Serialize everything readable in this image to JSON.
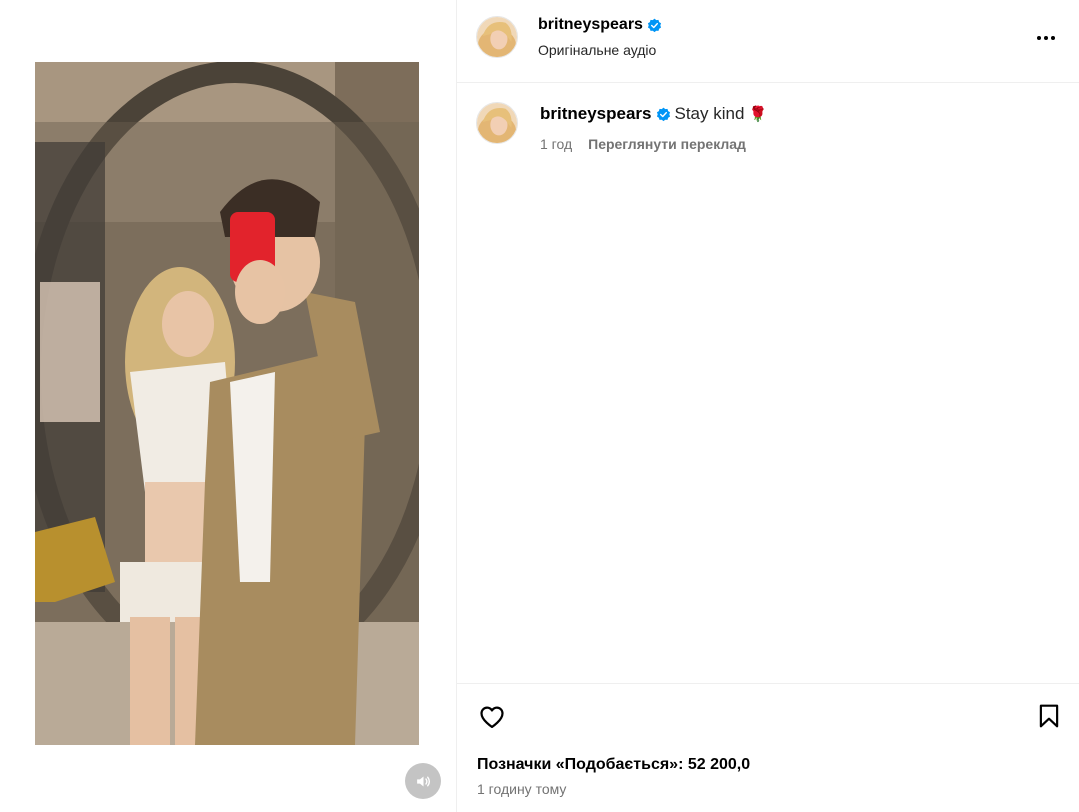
{
  "post": {
    "username": "britneyspears",
    "verified": true,
    "audio_label": "Оригінальне аудіо",
    "media_description_icon": "mirror-selfie-photo"
  },
  "comment": {
    "username": "britneyspears",
    "text": "Stay kind",
    "emoji": "🌹",
    "time": "1 год",
    "translate_label": "Переглянути переклад"
  },
  "actions": {
    "likes_label": "Позначки «Подобається»: 52 200,0",
    "timestamp": "1 годину тому"
  },
  "icons": {
    "like": "heart-icon",
    "save": "bookmark-icon",
    "more": "more-options-icon",
    "mute": "speaker-icon",
    "verified": "verified-badge-icon"
  },
  "colors": {
    "verified_blue": "#0095f6",
    "secondary_text": "#737373",
    "divider": "#efefef"
  }
}
